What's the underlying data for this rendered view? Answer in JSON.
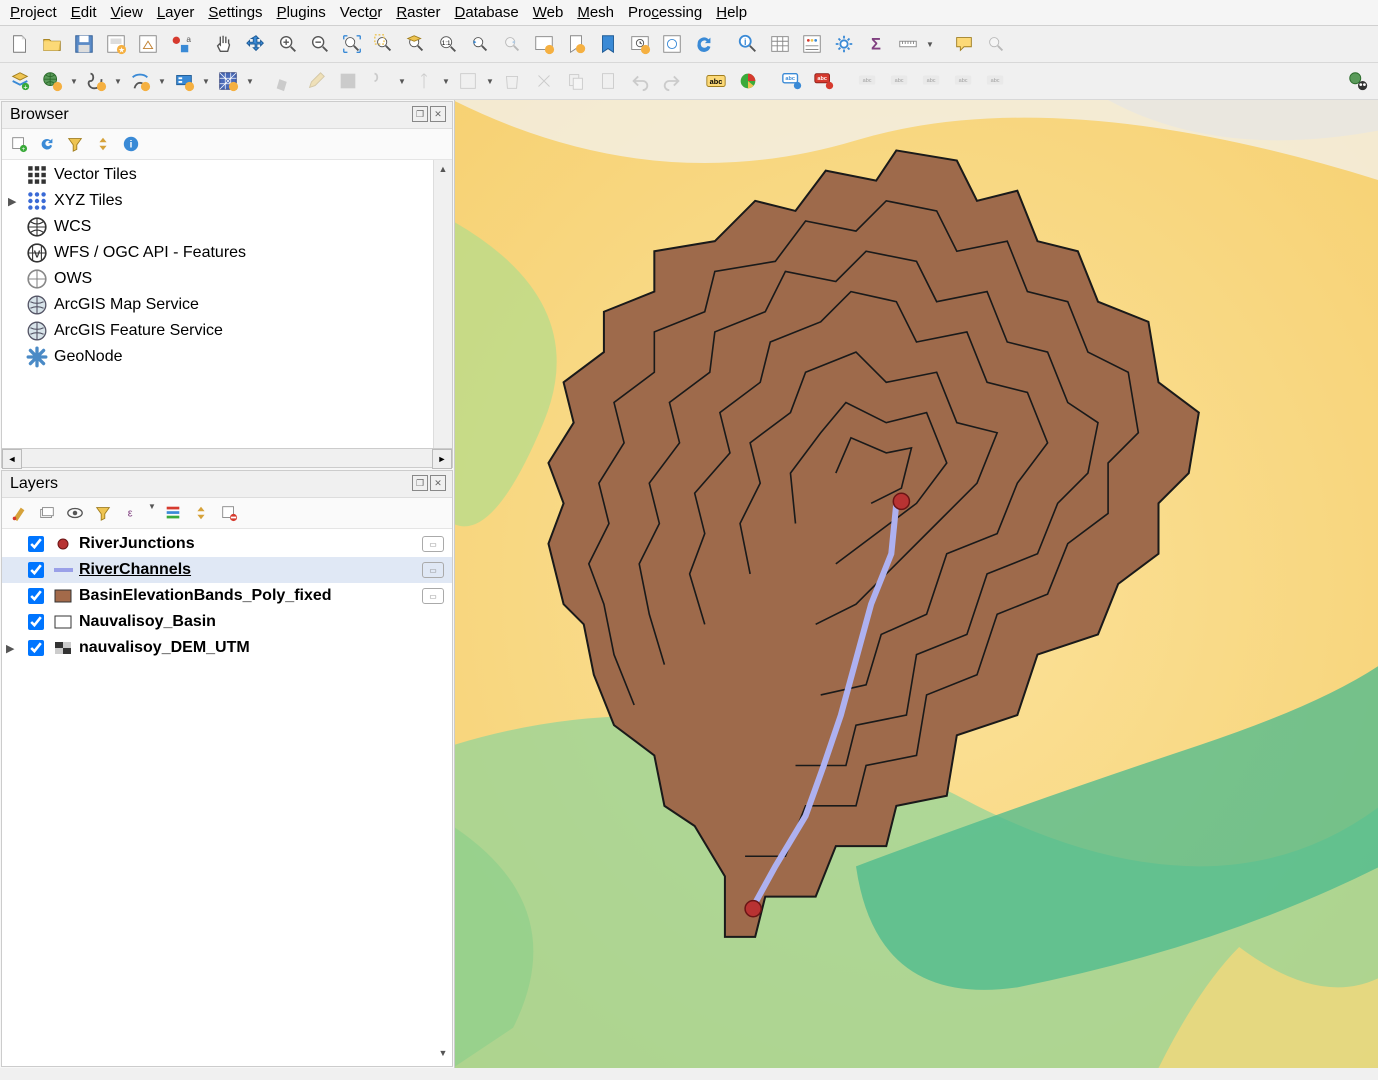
{
  "menu": [
    "Project",
    "Edit",
    "View",
    "Layer",
    "Settings",
    "Plugins",
    "Vector",
    "Raster",
    "Database",
    "Web",
    "Mesh",
    "Processing",
    "Help"
  ],
  "panels": {
    "browser": {
      "title": "Browser"
    },
    "layers": {
      "title": "Layers"
    }
  },
  "browser_items": [
    {
      "label": "Vector Tiles",
      "icon": "grid",
      "expandable": false
    },
    {
      "label": "XYZ Tiles",
      "icon": "dots-grid",
      "expandable": true
    },
    {
      "label": "WCS",
      "icon": "globe-lines",
      "expandable": false
    },
    {
      "label": "WFS / OGC API - Features",
      "icon": "globe-v",
      "expandable": false
    },
    {
      "label": "OWS",
      "icon": "globe-wire",
      "expandable": false
    },
    {
      "label": "ArcGIS Map Service",
      "icon": "globe-arc",
      "expandable": false
    },
    {
      "label": "ArcGIS Feature Service",
      "icon": "globe-arc",
      "expandable": false
    },
    {
      "label": "GeoNode",
      "icon": "asterisk",
      "expandable": false
    }
  ],
  "layers": [
    {
      "name": "RiverJunctions",
      "checked": true,
      "sym": "point",
      "color": "#b83232",
      "chip": true,
      "selected": false,
      "underline": false,
      "expandable": false
    },
    {
      "name": "RiverChannels",
      "checked": true,
      "sym": "line",
      "color": "#9aa0e8",
      "chip": true,
      "selected": true,
      "underline": true,
      "expandable": false
    },
    {
      "name": "BasinElevationBands_Poly_fixed",
      "checked": true,
      "sym": "poly",
      "color": "#a36a4a",
      "chip": true,
      "selected": false,
      "underline": false,
      "expandable": false
    },
    {
      "name": "Nauvalisoy_Basin",
      "checked": true,
      "sym": "poly-outline",
      "color": "#ffffff",
      "chip": false,
      "selected": false,
      "underline": false,
      "expandable": false
    },
    {
      "name": "nauvalisoy_DEM_UTM",
      "checked": true,
      "sym": "raster",
      "color": "#808080",
      "chip": false,
      "selected": false,
      "underline": false,
      "expandable": true
    }
  ],
  "map": {
    "basin_fill": "#9e6a4b",
    "basin_stroke": "#1a1a1a",
    "river_color": "#aeb1f0",
    "junction_fill": "#b83232",
    "junction_stroke": "#6a1515"
  }
}
